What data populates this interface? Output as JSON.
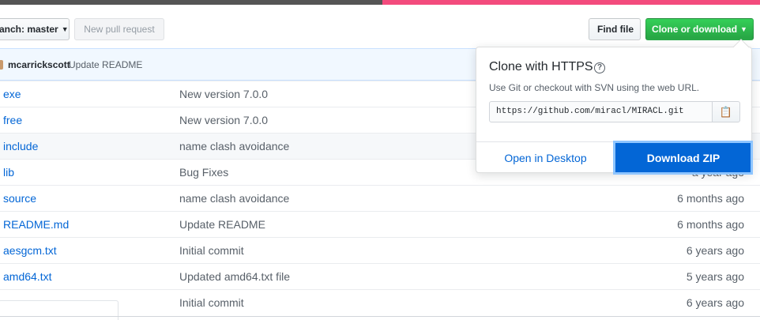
{
  "colors": {
    "lang_c": "#555555",
    "lang_cpp": "#f34b7d",
    "clone_button": "#28a745",
    "link": "#0366d6",
    "download_button": "#0366d6"
  },
  "toolbar": {
    "branch_label": "anch: master",
    "new_pr_label": "New pull request",
    "find_file_label": "Find file",
    "clone_label": "Clone or download"
  },
  "commit": {
    "author": "mcarrickscott",
    "message": "Update README"
  },
  "files": [
    {
      "name": "exe",
      "message": "New version 7.0.0",
      "age": ""
    },
    {
      "name": "free",
      "message": "New version 7.0.0",
      "age": ""
    },
    {
      "name": "include",
      "message": "name clash avoidance",
      "age": ""
    },
    {
      "name": "lib",
      "message": "Bug Fixes",
      "age": "a year ago"
    },
    {
      "name": "source",
      "message": "name clash avoidance",
      "age": "6 months ago"
    },
    {
      "name": "README.md",
      "message": "Update README",
      "age": "6 months ago"
    },
    {
      "name": "aesgcm.txt",
      "message": "Initial commit",
      "age": "6 years ago"
    },
    {
      "name": "amd64.txt",
      "message": "Updated amd64.txt file",
      "age": "5 years ago"
    },
    {
      "name": "",
      "message": "Initial commit",
      "age": "6 years ago"
    }
  ],
  "clone_dropdown": {
    "title": "Clone with HTTPS",
    "help_icon": "question-circle-icon",
    "description": "Use Git or checkout with SVN using the web URL.",
    "url": "https://github.com/miracl/MIRACL.git",
    "copy_icon": "clipboard-icon",
    "open_desktop_label": "Open in Desktop",
    "download_zip_label": "Download ZIP"
  }
}
